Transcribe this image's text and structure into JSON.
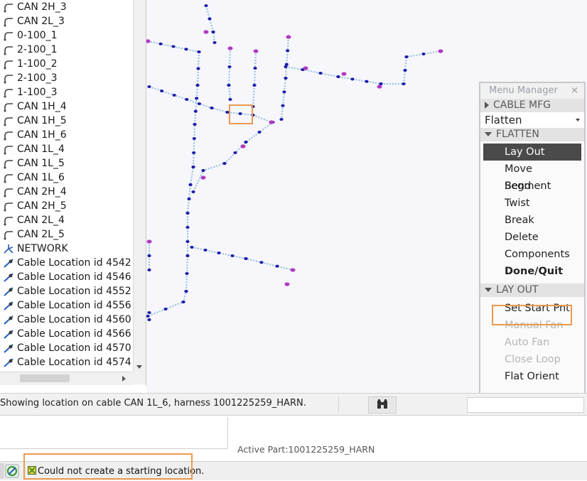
{
  "model_tree": {
    "items": [
      {
        "label": "CAN 2H_3",
        "icon": "cable-icon"
      },
      {
        "label": "CAN 2L_3",
        "icon": "cable-icon"
      },
      {
        "label": "0-100_1",
        "icon": "cable-icon"
      },
      {
        "label": "2-100_1",
        "icon": "cable-icon"
      },
      {
        "label": "1-100_2",
        "icon": "cable-icon"
      },
      {
        "label": "2-100_3",
        "icon": "cable-icon"
      },
      {
        "label": "1-100_3",
        "icon": "cable-icon"
      },
      {
        "label": "CAN 1H_4",
        "icon": "cable-icon"
      },
      {
        "label": "CAN 1H_5",
        "icon": "cable-icon"
      },
      {
        "label": "CAN 1H_6",
        "icon": "cable-icon"
      },
      {
        "label": "CAN 1L_4",
        "icon": "cable-icon"
      },
      {
        "label": "CAN 1L_5",
        "icon": "cable-icon"
      },
      {
        "label": "CAN 1L_6",
        "icon": "cable-icon"
      },
      {
        "label": "CAN 2H_4",
        "icon": "cable-icon"
      },
      {
        "label": "CAN 2H_5",
        "icon": "cable-icon"
      },
      {
        "label": "CAN 2L_4",
        "icon": "cable-icon"
      },
      {
        "label": "CAN 2L_5",
        "icon": "cable-icon"
      },
      {
        "label": "NETWORK",
        "icon": "network-icon"
      },
      {
        "label": "Cable Location id 4542",
        "icon": "cable-location-icon"
      },
      {
        "label": "Cable Location id 4546",
        "icon": "cable-location-icon"
      },
      {
        "label": "Cable Location id 4552",
        "icon": "cable-location-icon"
      },
      {
        "label": "Cable Location id 4556",
        "icon": "cable-location-icon"
      },
      {
        "label": "Cable Location id 4560",
        "icon": "cable-location-icon"
      },
      {
        "label": "Cable Location id 4566",
        "icon": "cable-location-icon"
      },
      {
        "label": "Cable Location id 4570",
        "icon": "cable-location-icon"
      },
      {
        "label": "Cable Location id 4574",
        "icon": "cable-location-icon"
      }
    ]
  },
  "menu_manager": {
    "title": "Menu Manager",
    "close_glyph": "×",
    "section_cable_mfg": "CABLE MFG",
    "mode_select": "Flatten",
    "section_flatten": "FLATTEN",
    "flatten_items": [
      {
        "label": "Lay Out",
        "state": "selected"
      },
      {
        "label": "Move Segment",
        "state": "normal"
      },
      {
        "label": "Bend",
        "state": "normal"
      },
      {
        "label": "Twist",
        "state": "normal"
      },
      {
        "label": "Break",
        "state": "normal"
      },
      {
        "label": "Delete",
        "state": "normal"
      },
      {
        "label": "Components",
        "state": "normal"
      },
      {
        "label": "Done/Quit",
        "state": "bold"
      }
    ],
    "section_layout": "LAY OUT",
    "layout_items": [
      {
        "label": "Set Start Pnt",
        "state": "normal"
      },
      {
        "label": "Manual Fan",
        "state": "disabled"
      },
      {
        "label": "Auto Fan",
        "state": "disabled"
      },
      {
        "label": "Close Loop",
        "state": "disabled"
      },
      {
        "label": "Flat Orient",
        "state": "normal"
      }
    ]
  },
  "status": {
    "text": "Showing location on cable CAN 1L_6, harness 1001225259_HARN."
  },
  "message_area": {
    "active_part": "Active Part:1001225259_HARN"
  },
  "bottom_bar": {
    "message": "Could not create a starting location."
  },
  "colors": {
    "highlight_box": "#ec9a50",
    "cable_node": "#1c1ca8",
    "cable_endpoint": "#b03ac0",
    "segment_line": "#8fbfe0",
    "selected_menu": "#4a4a4a"
  }
}
